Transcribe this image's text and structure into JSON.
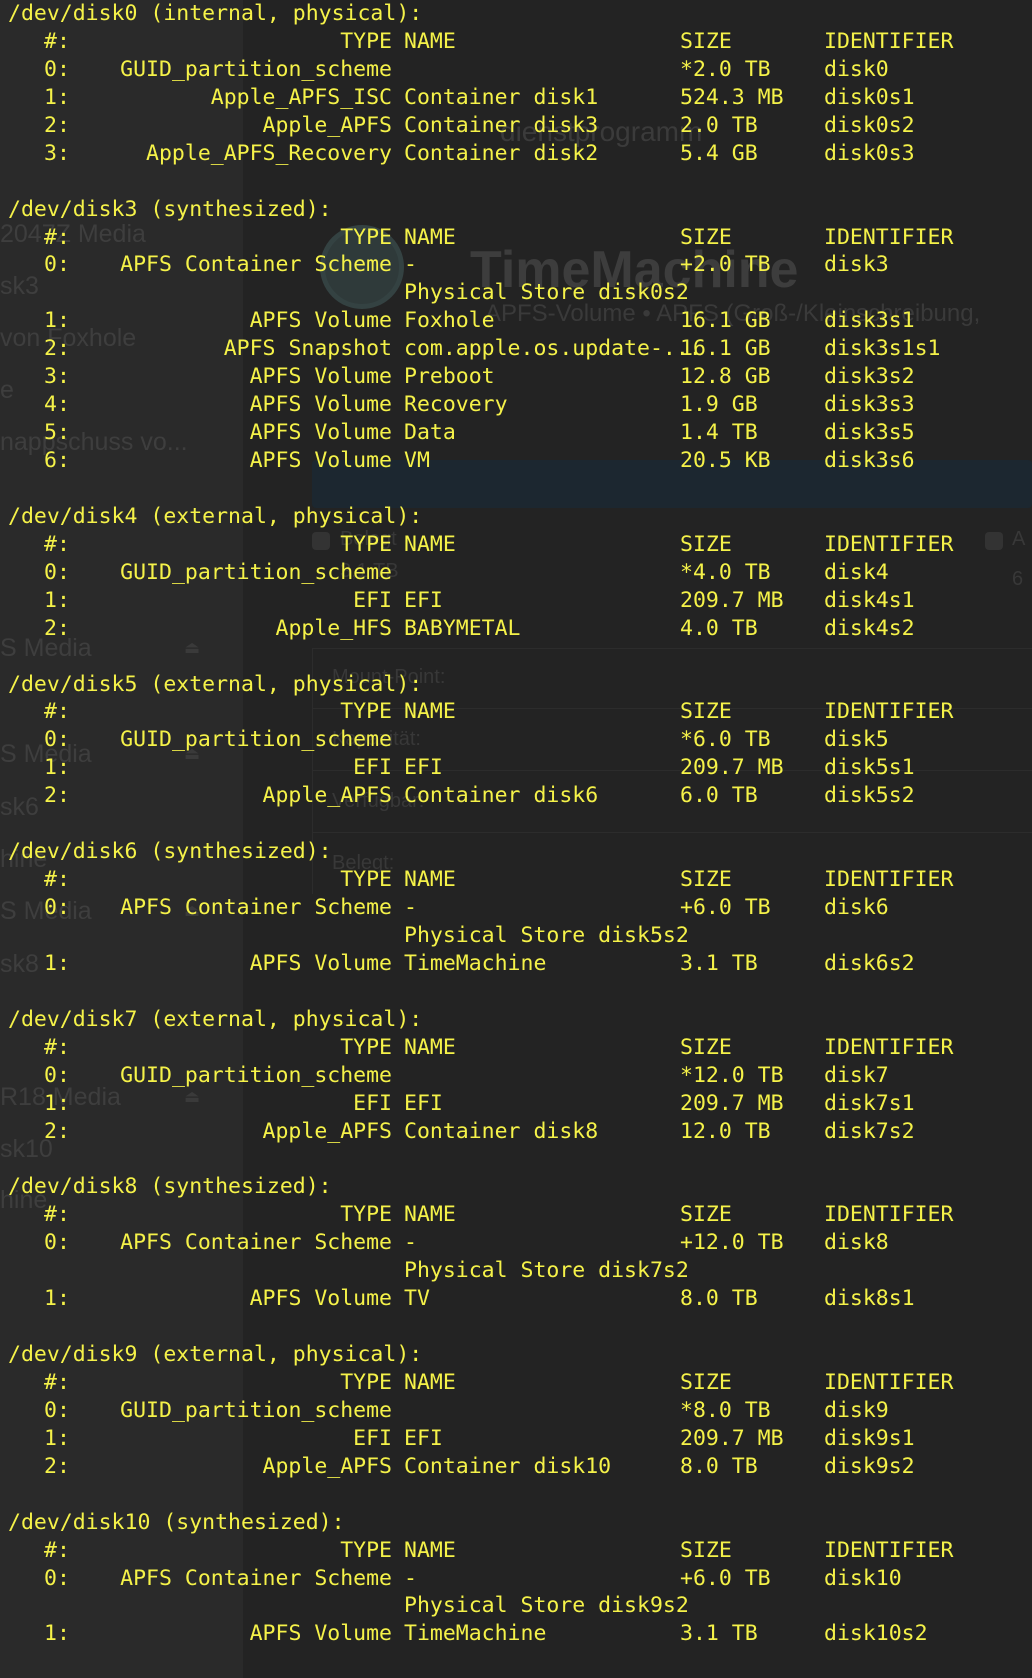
{
  "background_window": {
    "title": "dienstprogramm",
    "volume_title": "TimeMachine",
    "volume_subtitle": "APFS-Volume • APFS (Groß-/Kleinschreibung,",
    "sidebar_items": [
      "2047Z Media",
      "sk3",
      "von Foxhole",
      "e",
      "nappschuss vo...",
      "S Media",
      "S Media",
      "sk6",
      "hine",
      "S Media",
      "sk8",
      "R18 Media",
      "sk10",
      "hine"
    ],
    "labels": {
      "used": "Belegt",
      "used_value": "3,1 TB",
      "mount_point": "Mount-Point:",
      "capacity": "Kapazität:",
      "available": "Verfügbar:",
      "used2": "Belegt:",
      "right_col": "A",
      "right_val": "6"
    }
  },
  "terminal": {
    "header_labels": {
      "id": "#:",
      "type": "TYPE",
      "name": "NAME",
      "size": "SIZE",
      "identifier": "IDENTIFIER"
    },
    "disks": [
      {
        "device": "/dev/disk0 (internal, physical):",
        "partitions": [
          {
            "id": "0:",
            "type": "GUID_partition_scheme",
            "name": "",
            "size": "*2.0 TB",
            "identifier": "disk0"
          },
          {
            "id": "1:",
            "type": "Apple_APFS_ISC",
            "name": "Container disk1",
            "size": "524.3 MB",
            "identifier": "disk0s1"
          },
          {
            "id": "2:",
            "type": "Apple_APFS",
            "name": "Container disk3",
            "size": "2.0 TB",
            "identifier": "disk0s2"
          },
          {
            "id": "3:",
            "type": "Apple_APFS_Recovery",
            "name": "Container disk2",
            "size": "5.4 GB",
            "identifier": "disk0s3"
          }
        ]
      },
      {
        "device": "/dev/disk3 (synthesized):",
        "partitions": [
          {
            "id": "0:",
            "type": "APFS Container Scheme",
            "name": "-",
            "size": "+2.0 TB",
            "identifier": "disk3",
            "extra": "Physical Store disk0s2"
          },
          {
            "id": "1:",
            "type": "APFS Volume",
            "name": "Foxhole",
            "size": "16.1 GB",
            "identifier": "disk3s1"
          },
          {
            "id": "2:",
            "type": "APFS Snapshot",
            "name": "com.apple.os.update-...",
            "size": "16.1 GB",
            "identifier": "disk3s1s1"
          },
          {
            "id": "3:",
            "type": "APFS Volume",
            "name": "Preboot",
            "size": "12.8 GB",
            "identifier": "disk3s2"
          },
          {
            "id": "4:",
            "type": "APFS Volume",
            "name": "Recovery",
            "size": "1.9 GB",
            "identifier": "disk3s3"
          },
          {
            "id": "5:",
            "type": "APFS Volume",
            "name": "Data",
            "size": "1.4 TB",
            "identifier": "disk3s5"
          },
          {
            "id": "6:",
            "type": "APFS Volume",
            "name": "VM",
            "size": "20.5 KB",
            "identifier": "disk3s6"
          }
        ]
      },
      {
        "device": "/dev/disk4 (external, physical):",
        "partitions": [
          {
            "id": "0:",
            "type": "GUID_partition_scheme",
            "name": "",
            "size": "*4.0 TB",
            "identifier": "disk4"
          },
          {
            "id": "1:",
            "type": "EFI",
            "name": "EFI",
            "size": "209.7 MB",
            "identifier": "disk4s1"
          },
          {
            "id": "2:",
            "type": "Apple_HFS",
            "name": "BABYMETAL",
            "size": "4.0 TB",
            "identifier": "disk4s2"
          }
        ]
      },
      {
        "device": "/dev/disk5 (external, physical):",
        "partitions": [
          {
            "id": "0:",
            "type": "GUID_partition_scheme",
            "name": "",
            "size": "*6.0 TB",
            "identifier": "disk5"
          },
          {
            "id": "1:",
            "type": "EFI",
            "name": "EFI",
            "size": "209.7 MB",
            "identifier": "disk5s1"
          },
          {
            "id": "2:",
            "type": "Apple_APFS",
            "name": "Container disk6",
            "size": "6.0 TB",
            "identifier": "disk5s2"
          }
        ]
      },
      {
        "device": "/dev/disk6 (synthesized):",
        "partitions": [
          {
            "id": "0:",
            "type": "APFS Container Scheme",
            "name": "-",
            "size": "+6.0 TB",
            "identifier": "disk6",
            "extra": "Physical Store disk5s2"
          },
          {
            "id": "1:",
            "type": "APFS Volume",
            "name": "TimeMachine",
            "size": "3.1 TB",
            "identifier": "disk6s2"
          }
        ]
      },
      {
        "device": "/dev/disk7 (external, physical):",
        "partitions": [
          {
            "id": "0:",
            "type": "GUID_partition_scheme",
            "name": "",
            "size": "*12.0 TB",
            "identifier": "disk7"
          },
          {
            "id": "1:",
            "type": "EFI",
            "name": "EFI",
            "size": "209.7 MB",
            "identifier": "disk7s1"
          },
          {
            "id": "2:",
            "type": "Apple_APFS",
            "name": "Container disk8",
            "size": "12.0 TB",
            "identifier": "disk7s2"
          }
        ]
      },
      {
        "device": "/dev/disk8 (synthesized):",
        "partitions": [
          {
            "id": "0:",
            "type": "APFS Container Scheme",
            "name": "-",
            "size": "+12.0 TB",
            "identifier": "disk8",
            "extra": "Physical Store disk7s2"
          },
          {
            "id": "1:",
            "type": "APFS Volume",
            "name": "TV",
            "size": "8.0 TB",
            "identifier": "disk8s1"
          }
        ]
      },
      {
        "device": "/dev/disk9 (external, physical):",
        "partitions": [
          {
            "id": "0:",
            "type": "GUID_partition_scheme",
            "name": "",
            "size": "*8.0 TB",
            "identifier": "disk9"
          },
          {
            "id": "1:",
            "type": "EFI",
            "name": "EFI",
            "size": "209.7 MB",
            "identifier": "disk9s1"
          },
          {
            "id": "2:",
            "type": "Apple_APFS",
            "name": "Container disk10",
            "size": "8.0 TB",
            "identifier": "disk9s2"
          }
        ]
      },
      {
        "device": "/dev/disk10 (synthesized):",
        "partitions": [
          {
            "id": "0:",
            "type": "APFS Container Scheme",
            "name": "-",
            "size": "+6.0 TB",
            "identifier": "disk10",
            "extra": "Physical Store disk9s2"
          },
          {
            "id": "1:",
            "type": "APFS Volume",
            "name": "TimeMachine",
            "size": "3.1 TB",
            "identifier": "disk10s2"
          }
        ]
      }
    ]
  }
}
